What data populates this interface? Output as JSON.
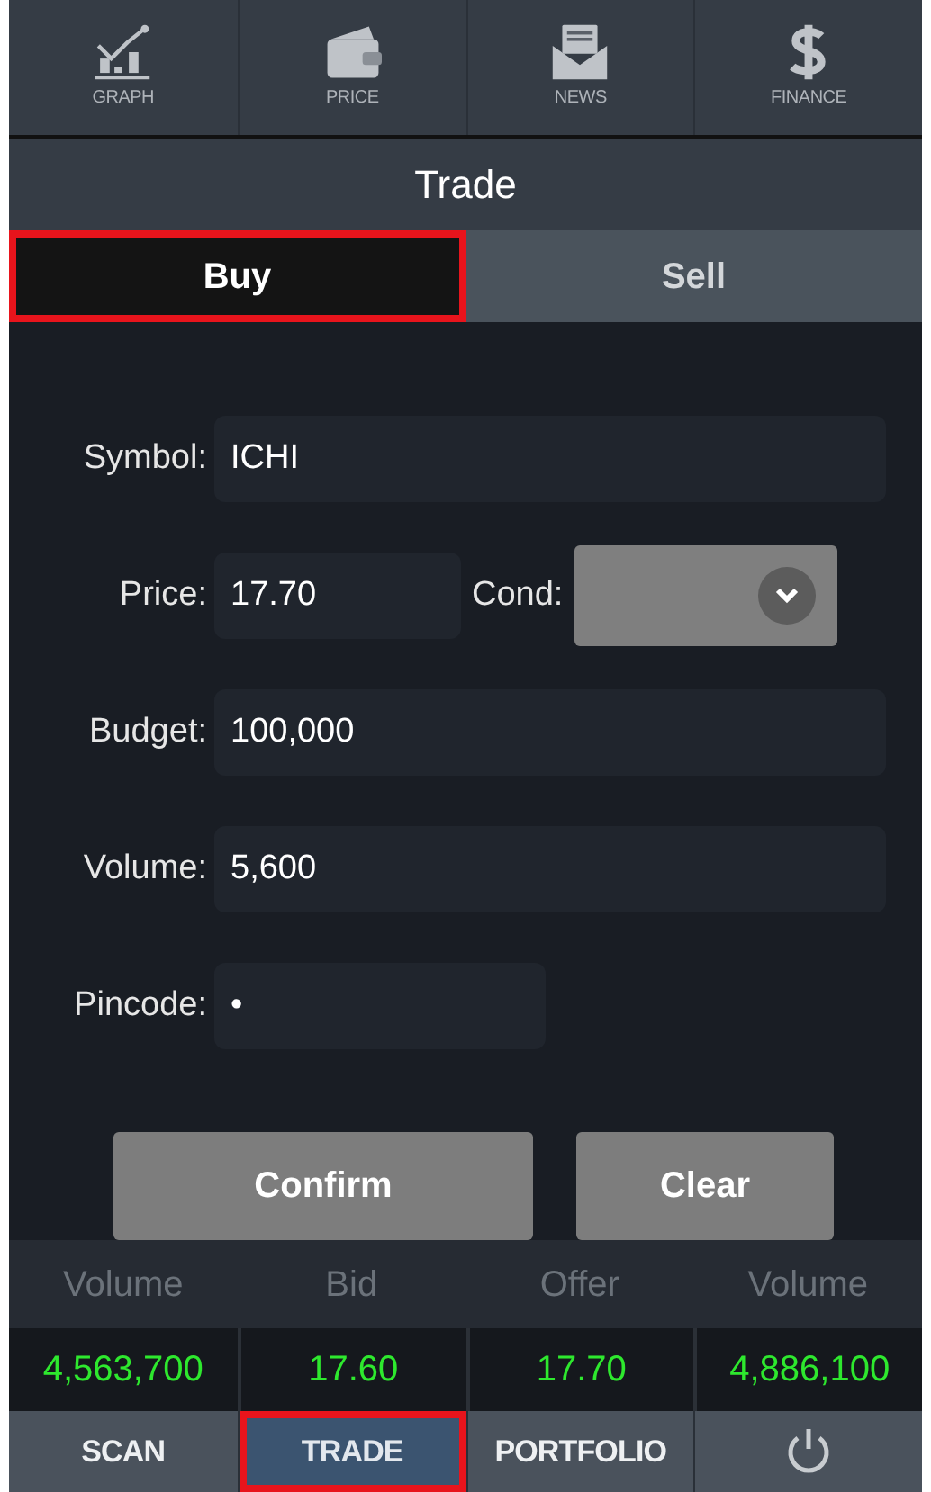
{
  "top_nav": [
    {
      "kind": "graph",
      "label": "GRAPH"
    },
    {
      "kind": "price",
      "label": "PRICE"
    },
    {
      "kind": "news",
      "label": "NEWS"
    },
    {
      "kind": "finance",
      "label": "FINANCE"
    }
  ],
  "title": "Trade",
  "tabs": [
    {
      "label": "Buy",
      "selected": true,
      "highlighted": true
    },
    {
      "label": "Sell",
      "selected": false,
      "highlighted": false
    }
  ],
  "form": {
    "rows": [
      [
        {
          "label": "Symbol:",
          "value": "ICHI",
          "kind": "text"
        }
      ],
      [
        {
          "label": "Price:",
          "value": "17.70",
          "kind": "text"
        },
        {
          "label": "Cond:",
          "kind": "select"
        }
      ],
      [
        {
          "label": "Budget:",
          "value": "100,000",
          "kind": "text"
        }
      ],
      [
        {
          "label": "Volume:",
          "value": "5,600",
          "kind": "text"
        }
      ],
      [
        {
          "label": "Pincode:",
          "value": "•",
          "kind": "pin"
        }
      ]
    ],
    "buttons": [
      "Confirm",
      "Clear"
    ]
  },
  "quote": {
    "columns": [
      "Volume",
      "Bid",
      "Offer",
      "Volume"
    ],
    "values": [
      "4,563,700",
      "17.60",
      "17.70",
      "4,886,100"
    ]
  },
  "bottom_nav": [
    {
      "kind": "text",
      "label": "SCAN",
      "selected": false,
      "highlighted": false
    },
    {
      "kind": "text",
      "label": "TRADE",
      "selected": true,
      "highlighted": true
    },
    {
      "kind": "text",
      "label": "PORTFOLIO",
      "selected": false,
      "highlighted": false
    },
    {
      "kind": "power",
      "selected": false,
      "highlighted": false
    }
  ]
}
